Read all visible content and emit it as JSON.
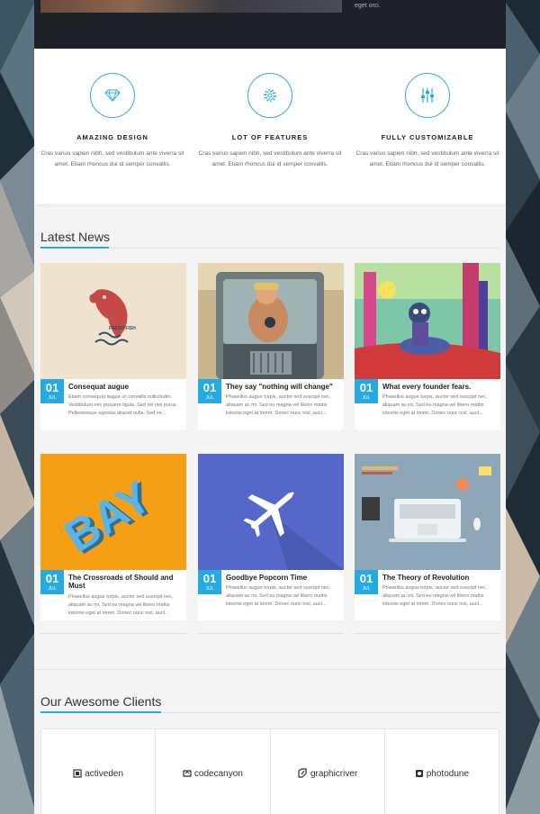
{
  "hero": {
    "caption": "eget orci."
  },
  "features": [
    {
      "icon": "diamond-icon",
      "title": "AMAZING DESIGN",
      "text": "Cras varius sapien nibh, sed vestibulum ante viverra sit amet. Etiam rhoncus dui id semper convallis."
    },
    {
      "icon": "gear-icon",
      "title": "LOT OF FEATURES",
      "text": "Cras varius sapien nibh, sed vestibulum ante viverra sit amet. Etiam rhoncus dui id semper convallis."
    },
    {
      "icon": "sliders-icon",
      "title": "FULLY CUSTOMIZABLE",
      "text": "Cras varius sapien nibh, sed vestibulum ante viverra sit amet. Etiam rhoncus dui id semper convallis."
    }
  ],
  "news": {
    "title": "Latest News",
    "posts": [
      {
        "day": "01",
        "month": "JUL",
        "title": "Consequat augue",
        "excerpt": "Etiam consequat augue ut convallis sollicitudin. Vestibulum nec posuere ligula. Sed vel nisi purus. Pellentesque egestas aliquet nulla. Sed ve...",
        "thumb": "fresh-fish",
        "thumb_text": "FRESH FISH"
      },
      {
        "day": "01",
        "month": "JUL",
        "title": "They say \"nothing will change\"",
        "excerpt": "Phasellus augue turpis, auctor sed suscipit nec, aliquam ac mi. Sed eu magna vel libero mattis lobortis eget at lorem. Donec nunc nisl, auct...",
        "thumb": "truck-driver"
      },
      {
        "day": "01",
        "month": "JUL",
        "title": "What every founder fears.",
        "excerpt": "Phasellus augue turpis, auctor sed suscipit nec, aliquam ac mi. Sed eu magna vel libero mattis lobortis eget at lorem. Donec nunc nisl, auct...",
        "thumb": "forest-character"
      },
      {
        "day": "01",
        "month": "JUL",
        "title": "The Crossroads of Should and Must",
        "excerpt": "Phasellus augue turpis, auctor sed suscipit nec, aliquam ac mi. Sed eu magna vel libero mattis lobortis eget at lorem. Donec nunc nisl, auct...",
        "thumb": "bay-letters",
        "thumb_text": "BAY"
      },
      {
        "day": "01",
        "month": "JUL",
        "title": "Goodbye Popcorn Time",
        "excerpt": "Phasellus augue turpis, auctor sed suscipit nec, aliquam ac mi. Sed eu magna vel libero mattis lobortis eget at lorem. Donec nunc nisl, auct...",
        "thumb": "airplane"
      },
      {
        "day": "01",
        "month": "JUL",
        "title": "The Theory of Revolution",
        "excerpt": "Phasellus augue turpis, auctor sed suscipit nec, aliquam ac mi. Sed eu magna vel libero mattis lobortis eget at lorem. Donec nunc nisl, auct...",
        "thumb": "workspace-laptop"
      }
    ]
  },
  "clients": {
    "title": "Our Awesome Clients",
    "items": [
      {
        "name": "activeden",
        "icon": "activeden-logo-icon"
      },
      {
        "name": "codecanyon",
        "icon": "codecanyon-logo-icon"
      },
      {
        "name": "graphicriver",
        "icon": "graphicriver-logo-icon"
      },
      {
        "name": "photodune",
        "icon": "photodune-logo-icon"
      }
    ]
  },
  "colors": {
    "accent": "#27aae1",
    "dark": "#1e2126",
    "section_bg": "#f4f4f4"
  }
}
